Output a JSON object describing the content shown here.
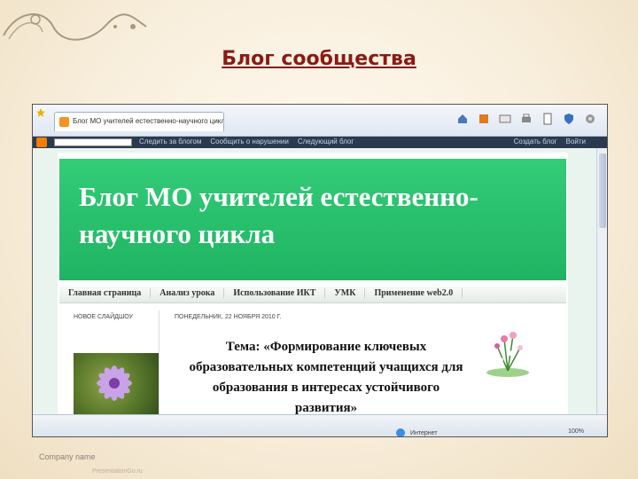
{
  "slide": {
    "title": "Блог сообщества",
    "footer_company": "Company name",
    "footer_url": "PresentationGo.ru"
  },
  "browser": {
    "tab_title": "Блог МО учителей естественно-научного цикла",
    "zone_text": "Интернет",
    "zoom_text": "100%",
    "icons": [
      "home-icon",
      "feeds-icon",
      "mail-icon",
      "print-icon",
      "page-icon",
      "safety-icon",
      "tools-icon"
    ]
  },
  "blogger_nav": {
    "links": [
      "Следить за блогом",
      "Сообщить о нарушении",
      "Следующий блог"
    ],
    "right_links": [
      "Создать блог",
      "Войти"
    ]
  },
  "blog": {
    "header_title": "Блог МО учителей естественно-научного цикла",
    "menu": [
      "Главная страница",
      "Анализ урока",
      "Использование ИКТ",
      "УМК",
      "Применение web2.0"
    ],
    "sidebar_title": "НОВОЕ СЛАЙДШОУ",
    "post_date": "ПОНЕДЕЛЬНИК, 22 НОЯБРЯ 2010 Г.",
    "post_title": "Тема: «Формирование ключевых образовательных компетенций учащихся для образования в интересах устойчивого развития»"
  },
  "colors": {
    "slide_title": "#8b1a14",
    "header_green": "#2dc56f",
    "nav_dark": "#2b3a4f"
  }
}
